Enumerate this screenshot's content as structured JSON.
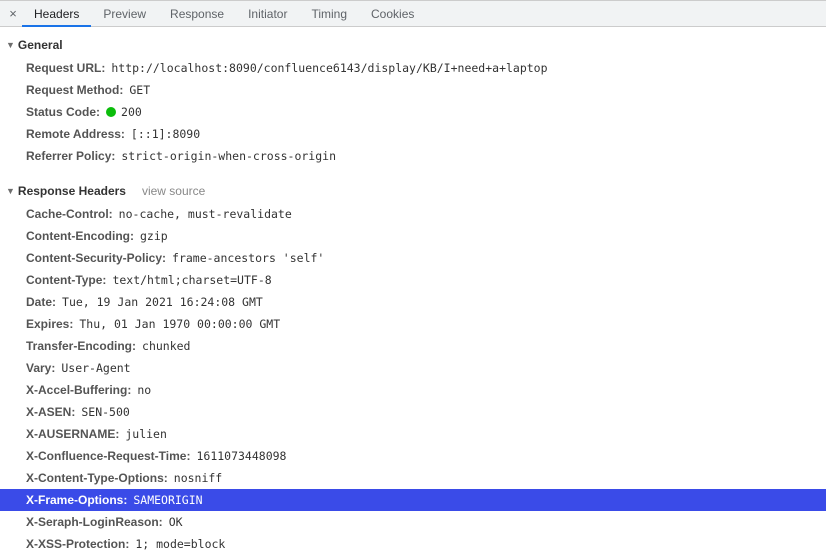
{
  "close_glyph": "×",
  "tabs": [
    {
      "label": "Headers",
      "active": true
    },
    {
      "label": "Preview",
      "active": false
    },
    {
      "label": "Response",
      "active": false
    },
    {
      "label": "Initiator",
      "active": false
    },
    {
      "label": "Timing",
      "active": false
    },
    {
      "label": "Cookies",
      "active": false
    }
  ],
  "sections": {
    "general": {
      "title": "General",
      "rows": [
        {
          "key": "Request URL",
          "value": "http://localhost:8090/confluence6143/display/KB/I+need+a+laptop"
        },
        {
          "key": "Request Method",
          "value": "GET"
        },
        {
          "key": "Status Code",
          "value": "200",
          "status_dot": true
        },
        {
          "key": "Remote Address",
          "value": "[::1]:8090"
        },
        {
          "key": "Referrer Policy",
          "value": "strict-origin-when-cross-origin"
        }
      ]
    },
    "response": {
      "title": "Response Headers",
      "view_source_label": "view source",
      "rows": [
        {
          "key": "Cache-Control",
          "value": "no-cache, must-revalidate"
        },
        {
          "key": "Content-Encoding",
          "value": "gzip"
        },
        {
          "key": "Content-Security-Policy",
          "value": "frame-ancestors 'self'"
        },
        {
          "key": "Content-Type",
          "value": "text/html;charset=UTF-8"
        },
        {
          "key": "Date",
          "value": "Tue, 19 Jan 2021 16:24:08 GMT"
        },
        {
          "key": "Expires",
          "value": "Thu, 01 Jan 1970 00:00:00 GMT"
        },
        {
          "key": "Transfer-Encoding",
          "value": "chunked"
        },
        {
          "key": "Vary",
          "value": "User-Agent"
        },
        {
          "key": "X-Accel-Buffering",
          "value": "no"
        },
        {
          "key": "X-ASEN",
          "value": "SEN-500"
        },
        {
          "key": "X-AUSERNAME",
          "value": "julien"
        },
        {
          "key": "X-Confluence-Request-Time",
          "value": "1611073448098"
        },
        {
          "key": "X-Content-Type-Options",
          "value": "nosniff"
        },
        {
          "key": "X-Frame-Options",
          "value": "SAMEORIGIN",
          "selected": true
        },
        {
          "key": "X-Seraph-LoginReason",
          "value": "OK"
        },
        {
          "key": "X-XSS-Protection",
          "value": "1; mode=block"
        }
      ]
    }
  }
}
